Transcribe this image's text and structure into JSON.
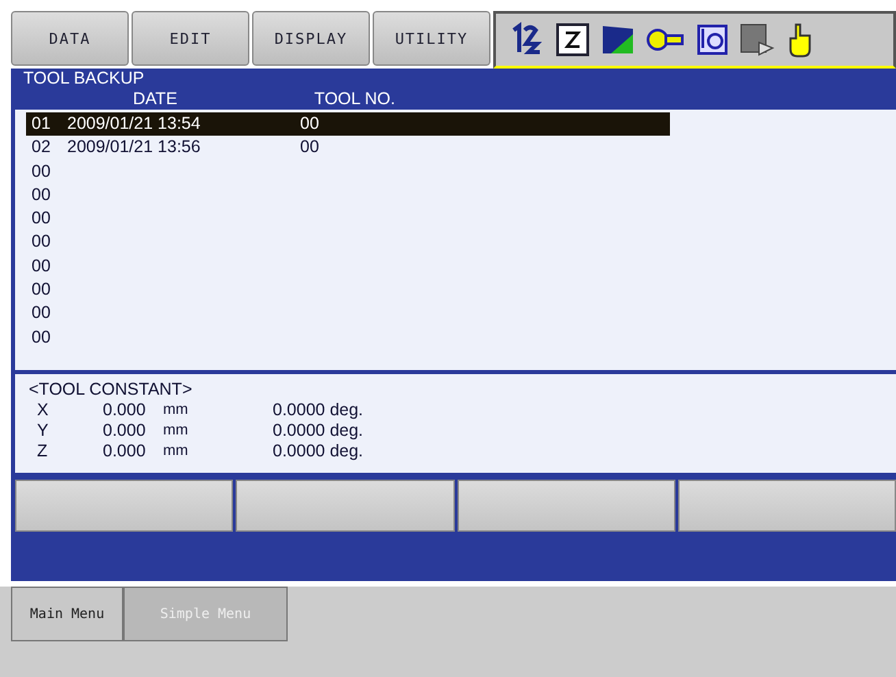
{
  "menu_tabs": [
    {
      "label": "DATA"
    },
    {
      "label": "EDIT"
    },
    {
      "label": "DISPLAY"
    },
    {
      "label": "UTILITY"
    }
  ],
  "panel": {
    "title": "TOOL BACKUP",
    "columns": [
      "DATE",
      "TOOL NO."
    ],
    "rows": [
      {
        "index": "01",
        "date": "2009/01/21 13:54",
        "tool_no": "00",
        "selected": true
      },
      {
        "index": "02",
        "date": "2009/01/21 13:56",
        "tool_no": "00",
        "selected": false
      },
      {
        "index": "00",
        "selected": false
      },
      {
        "index": "00",
        "selected": false
      },
      {
        "index": "00",
        "selected": false
      },
      {
        "index": "00",
        "selected": false
      },
      {
        "index": "00",
        "selected": false
      },
      {
        "index": "00",
        "selected": false
      },
      {
        "index": "00",
        "selected": false
      },
      {
        "index": "00",
        "selected": false
      }
    ]
  },
  "tool_constant": {
    "title": "<TOOL CONSTANT>",
    "rows": [
      {
        "axis": "X",
        "value": "0.000",
        "unit": "mm",
        "angle": "0.0000 deg."
      },
      {
        "axis": "Y",
        "value": "0.000",
        "unit": "mm",
        "angle": "0.0000 deg."
      },
      {
        "axis": "Z",
        "value": "0.000",
        "unit": "mm",
        "angle": "0.0000 deg."
      }
    ]
  },
  "bottom_menu": [
    {
      "label": "Main Menu",
      "disabled": false
    },
    {
      "label": "Simple Menu",
      "disabled": true
    }
  ]
}
